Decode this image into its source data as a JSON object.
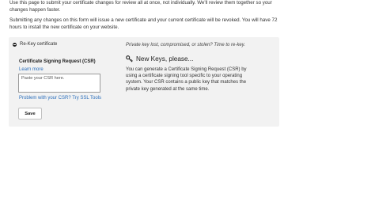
{
  "intro": {
    "paragraph1": "Use this page to submit your certificate changes for review all at once, not individually. We'll review them together so your changes happen faster.",
    "paragraph2": "Submitting any changes on this form will issue a new certificate and your current certificate will be revoked. You will have 72 hours to install the new certificate on your website."
  },
  "rekey": {
    "toggle_label": "Re-Key certificate",
    "csr_label": "Certificate Signing Request (CSR)",
    "learn_more": "Learn more",
    "csr_placeholder": "Paste your CSR here.",
    "csr_value": "",
    "problem_link": "Problem with your CSR? Try SSL Tools",
    "save_label": "Save"
  },
  "side": {
    "question": "Private key lost, compromised, or stolen? Time to re-key.",
    "heading": "New Keys, please...",
    "heading_icon": "key-icon",
    "body": "You can generate a Certificate Signing Request (CSR) by using a certificate signing tool specific to your operating system. Your CSR contains a public key that matches the private key generated at the same time."
  }
}
